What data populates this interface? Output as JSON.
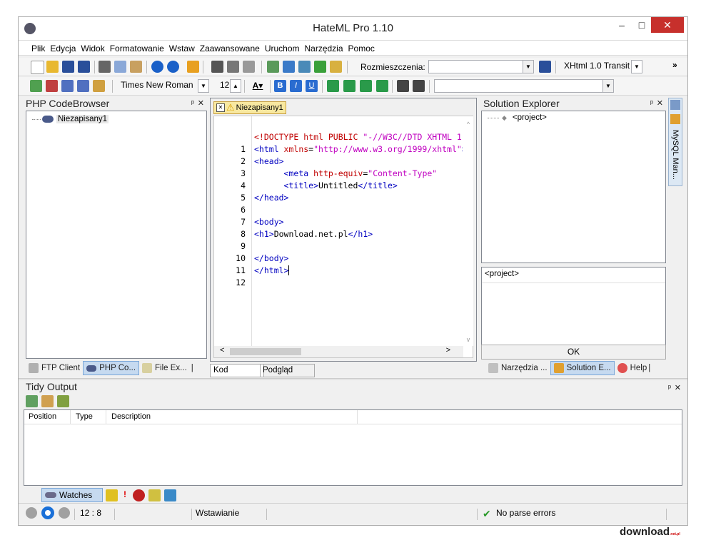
{
  "window": {
    "title": "HateML Pro 1.10",
    "minimize": "–",
    "maximize": "□",
    "close": "✕"
  },
  "menu": [
    "Plik",
    "Edycja",
    "Widok",
    "Formatowanie",
    "Wstaw",
    "Zaawansowane",
    "Uruchom",
    "Narzędzia",
    "Pomoc"
  ],
  "toolbar1": {
    "placement_label": "Rozmieszczenia:",
    "placement_value": "",
    "doctype": "XHtml 1.0 Transit",
    "overflow": "»"
  },
  "toolbar2": {
    "font": "Times New Roman",
    "size": "12",
    "style_value": ""
  },
  "code_browser": {
    "title": "PHP CodeBrowser",
    "tree_item": "Niezapisany1",
    "tabs": [
      "FTP Client",
      "PHP Co...",
      "File Ex..."
    ]
  },
  "editor": {
    "tab": "Niezapisany1",
    "bottom_tabs": [
      "Kod",
      "Podgląd"
    ],
    "line_numbers": [
      "1",
      "2",
      "3",
      "4",
      "5",
      "6",
      "7",
      "8",
      "9",
      "10",
      "11",
      "12"
    ]
  },
  "solution": {
    "title": "Solution Explorer",
    "tree_item": "<project>",
    "detail": "<project>",
    "ok": "OK",
    "tabs": [
      "Narzędzia ...",
      "Solution E...",
      "Help"
    ]
  },
  "side_tab": "MySQL Man...",
  "tidy": {
    "title": "Tidy Output",
    "columns": [
      "Position",
      "Type",
      "Description"
    ],
    "bottom_tab": "Watches"
  },
  "status": {
    "pos": "12 : 8",
    "mode": "Wstawianie",
    "parse": "No parse errors"
  },
  "watermark": {
    "text": "download",
    "suffix": ".net.pl"
  },
  "colors": {
    "tag": "#0000c0",
    "attr": "#c00000",
    "string": "#c000c0",
    "close": "#c7302c"
  }
}
